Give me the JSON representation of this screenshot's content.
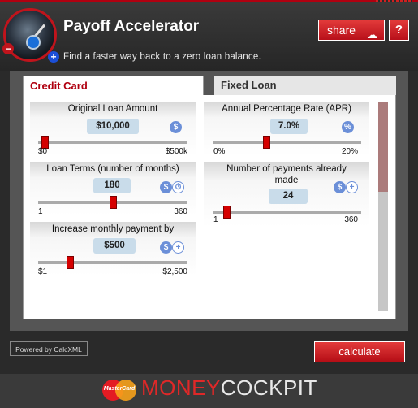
{
  "app": {
    "title": "Payoff Accelerator",
    "subtitle": "Find a faster way back to a zero loan balance.",
    "share_label": "share",
    "help_label": "?"
  },
  "tabs": [
    {
      "label": "Credit Card",
      "active": true
    },
    {
      "label": "Fixed Loan",
      "active": false
    }
  ],
  "left": {
    "loan_amount": {
      "label": "Original Loan Amount",
      "value": "$10,000",
      "min": "$0",
      "max": "$500k",
      "level": 0.02
    },
    "loan_terms": {
      "label": "Loan Terms (number of months)",
      "value": "180",
      "min": "1",
      "max": "360",
      "level": 0.5
    },
    "increase": {
      "label": "Increase monthly payment by",
      "value": "$500",
      "min": "$1",
      "max": "$2,500",
      "level": 0.2
    }
  },
  "right": {
    "apr": {
      "label": "Annual Percentage Rate (APR)",
      "value": "7.0%",
      "min": "0%",
      "max": "20%",
      "level": 0.35
    },
    "payments_made": {
      "label_line1": "Number of payments already",
      "label_line2": "made",
      "value": "24",
      "min": "1",
      "max": "360",
      "level": 0.07
    }
  },
  "footer": {
    "powered_by": "Powered by CalcXML",
    "calculate_label": "calculate",
    "mastercard_text": "MasterCard",
    "brand_money": "MONEY",
    "brand_cockpit": "COCKPIT"
  },
  "colors": {
    "accent_red": "#c0141c",
    "value_bg": "#c9dcea",
    "icon_blue": "#6b8fd8"
  },
  "icons": [
    "gauge-logo",
    "cloud-share-icon",
    "dollar-icon",
    "dollar-clock-icon",
    "dollar-percent-icon",
    "dollar-plus-icon",
    "mastercard-logo"
  ]
}
